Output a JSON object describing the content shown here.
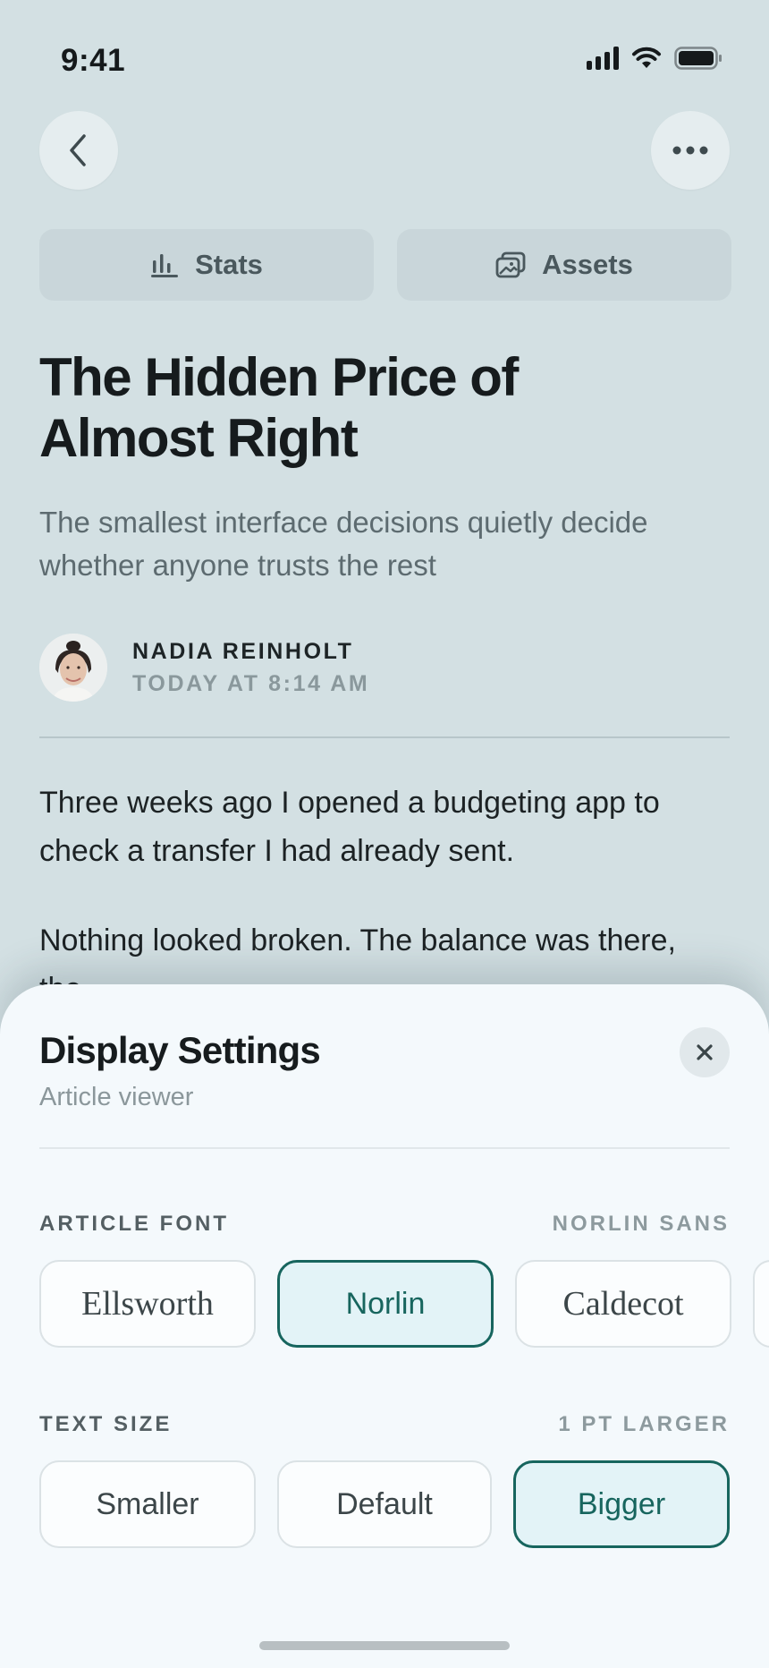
{
  "status_bar": {
    "time": "9:41"
  },
  "nav": {
    "back_icon": "chevron-left-icon",
    "more_icon": "ellipsis-icon"
  },
  "tabs": [
    {
      "label": "Stats",
      "icon": "bar-chart-icon"
    },
    {
      "label": "Assets",
      "icon": "images-icon"
    }
  ],
  "article": {
    "title_line1": "The Hidden Price of",
    "title_line2": "Almost Right",
    "subtitle": "The smallest interface decisions quietly decide whether anyone trusts the rest",
    "author": "NADIA REINHOLT",
    "timestamp": "TODAY AT 8:14 AM",
    "paragraph1": "Three weeks ago I opened a budgeting app to check a transfer I had already sent.",
    "paragraph2": "Nothing looked broken. The balance was there, the"
  },
  "sheet": {
    "title": "Display Settings",
    "subtitle": "Article viewer",
    "font_section": {
      "label": "ARTICLE FONT",
      "value": "NORLIN SANS",
      "options": [
        "Ellsworth",
        "Norlin",
        "Caldecot"
      ],
      "selected": "Norlin"
    },
    "size_section": {
      "label": "TEXT SIZE",
      "value": "1 PT LARGER",
      "options": [
        "Smaller",
        "Default",
        "Bigger"
      ],
      "selected": "Bigger"
    }
  },
  "colors": {
    "accent": "#17655e",
    "selected_bg": "#e3f3f7",
    "page_bg": "#d3e0e3",
    "sheet_bg": "#f4f9fc"
  }
}
